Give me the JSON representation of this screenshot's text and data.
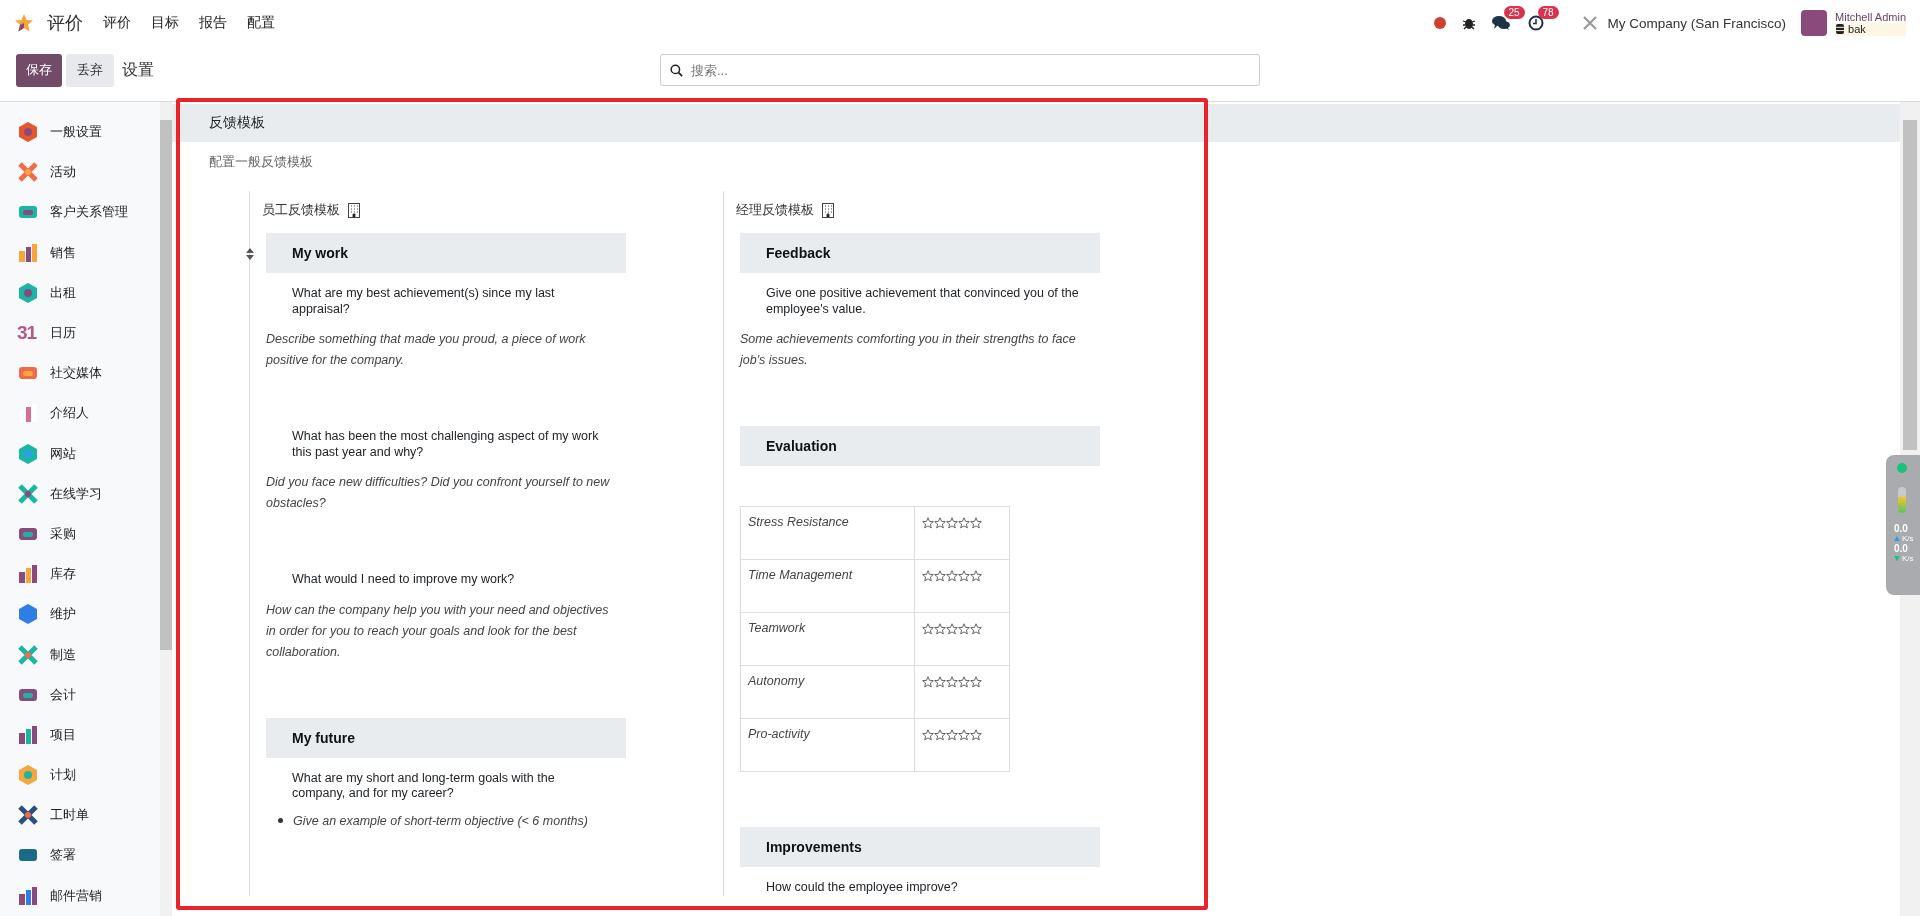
{
  "app": {
    "name": "评价",
    "menu": [
      "评价",
      "目标",
      "报告",
      "配置"
    ]
  },
  "toolbar": {
    "save": "保存",
    "discard": "丢弃",
    "breadcrumb": "设置",
    "search": {
      "placeholder": "搜索..."
    }
  },
  "systray": {
    "messages_count": "25",
    "activities_count": "78",
    "company": "My Company (San Francisco)",
    "user": "Mitchell Admin",
    "database": "bak"
  },
  "sidebar": {
    "items": [
      {
        "label": "一般设置"
      },
      {
        "label": "活动"
      },
      {
        "label": "客户关系管理"
      },
      {
        "label": "销售"
      },
      {
        "label": "出租"
      },
      {
        "label": "日历",
        "icon_text": "31"
      },
      {
        "label": "社交媒体"
      },
      {
        "label": "介绍人"
      },
      {
        "label": "网站"
      },
      {
        "label": "在线学习"
      },
      {
        "label": "采购"
      },
      {
        "label": "库存"
      },
      {
        "label": "维护"
      },
      {
        "label": "制造"
      },
      {
        "label": "会计"
      },
      {
        "label": "项目"
      },
      {
        "label": "计划"
      },
      {
        "label": "工时单"
      },
      {
        "label": "签署"
      },
      {
        "label": "邮件营销"
      }
    ]
  },
  "section": {
    "title": "反馈模板",
    "description": "配置一般反馈模板"
  },
  "employee_template": {
    "label": "员工反馈模板",
    "sections": [
      {
        "title": "My work",
        "items": [
          {
            "kind": "question",
            "text": "What are my best achievement(s) since my last appraisal?"
          },
          {
            "kind": "hint",
            "text": "Describe something that made you proud, a piece of work positive for the company."
          },
          {
            "kind": "question",
            "text": "What has been the most challenging aspect of my work this past year and why?"
          },
          {
            "kind": "hint",
            "text": "Did you face new difficulties? Did you confront yourself to new obstacles?"
          },
          {
            "kind": "question",
            "text": "What would I need to improve my work?"
          },
          {
            "kind": "hint",
            "text": "How can the company help you with your need and objectives in order for you to reach your goals and look for the best collaboration."
          }
        ]
      },
      {
        "title": "My future",
        "items": [
          {
            "kind": "question",
            "text": "What are my short and long-term goals with the company, and for my career?"
          },
          {
            "kind": "bullet",
            "text": "Give an example of short-term objective (< 6 months)"
          }
        ]
      }
    ]
  },
  "manager_template": {
    "label": "经理反馈模板",
    "sections": [
      {
        "title": "Feedback",
        "items": [
          {
            "kind": "question",
            "text": "Give one positive achievement that convinced you of the employee's value."
          },
          {
            "kind": "hint",
            "text": "Some achievements comforting you in their strengths to face job's issues."
          }
        ]
      },
      {
        "title": "Evaluation",
        "items": [
          {
            "kind": "rating_table",
            "rows": [
              {
                "criterion": "Stress Resistance",
                "stars": 0
              },
              {
                "criterion": "Time Management",
                "stars": 0
              },
              {
                "criterion": "Teamwork",
                "stars": 0
              },
              {
                "criterion": "Autonomy",
                "stars": 0
              },
              {
                "criterion": "Pro-activity",
                "stars": 0
              }
            ]
          }
        ]
      },
      {
        "title": "Improvements",
        "items": [
          {
            "kind": "question",
            "text": "How could the employee improve?"
          }
        ]
      }
    ]
  },
  "network_monitor": {
    "upload": {
      "value": "0.0",
      "unit": "K/s"
    },
    "download": {
      "value": "0.0",
      "unit": "K/s"
    }
  }
}
